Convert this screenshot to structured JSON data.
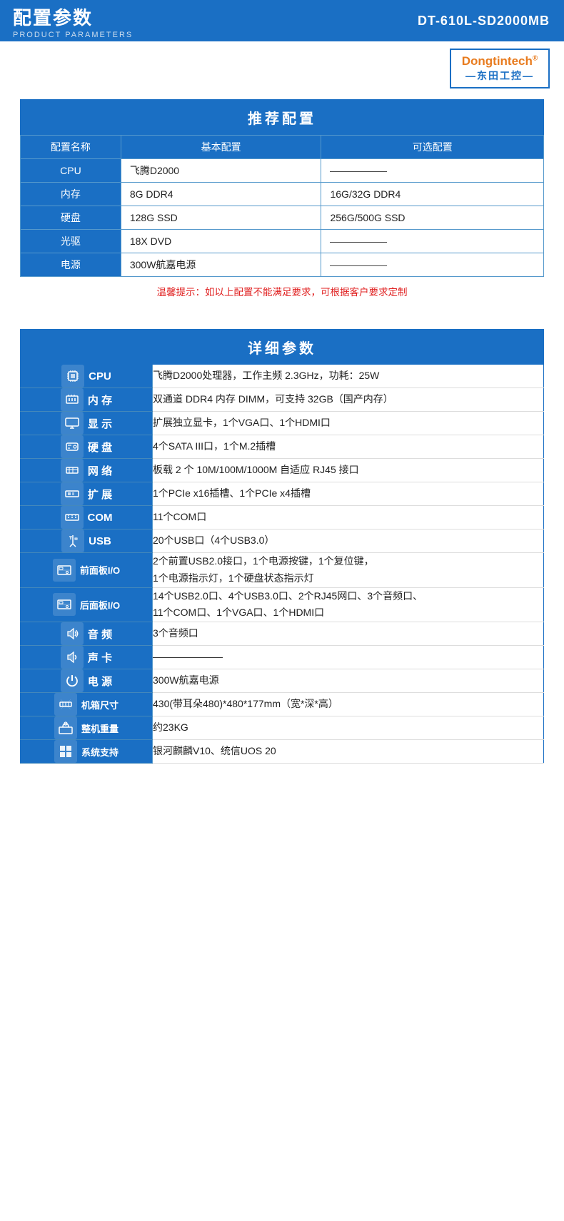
{
  "header": {
    "main_title": "配置参数",
    "sub_title": "PRODUCT PARAMETERS",
    "model": "DT-610L-SD2000MB"
  },
  "logo": {
    "brand_en": "Dongtintech",
    "brand_cn": "—东田工控—",
    "registered": "®"
  },
  "recommend": {
    "section_title": "推荐配置",
    "col_name": "配置名称",
    "col_basic": "基本配置",
    "col_optional": "可选配置",
    "rows": [
      {
        "name": "CPU",
        "basic": "飞腾D2000",
        "optional": "——"
      },
      {
        "name": "内存",
        "basic": "8G DDR4",
        "optional": "16G/32G DDR4"
      },
      {
        "name": "硬盘",
        "basic": "128G SSD",
        "optional": "256G/500G SSD"
      },
      {
        "name": "光驱",
        "basic": "18X DVD",
        "optional": "——"
      },
      {
        "name": "电源",
        "basic": "300W航嘉电源",
        "optional": "——"
      }
    ],
    "warm_tip": "温馨提示：如以上配置不能满足要求，可根据客户要求定制"
  },
  "detail": {
    "section_title": "详细参数",
    "rows": [
      {
        "label": "CPU",
        "icon": "cpu",
        "value": "飞腾D2000处理器，工作主频 2.3GHz，功耗：25W"
      },
      {
        "label": "内 存",
        "icon": "memory",
        "value": "双通道 DDR4 内存 DIMM，可支持 32GB（国产内存）"
      },
      {
        "label": "显 示",
        "icon": "display",
        "value": "扩展独立显卡，1个VGA口、1个HDMI口"
      },
      {
        "label": "硬 盘",
        "icon": "hdd",
        "value": "4个SATA III口，1个M.2插槽"
      },
      {
        "label": "网 络",
        "icon": "network",
        "value": "板载 2 个 10M/100M/1000M 自适应 RJ45 接口"
      },
      {
        "label": "扩 展",
        "icon": "expand",
        "value": "1个PCIe x16插槽、1个PCIe x4插槽"
      },
      {
        "label": "COM",
        "icon": "com",
        "value": "11个COM口"
      },
      {
        "label": "USB",
        "icon": "usb",
        "value": "20个USB口（4个USB3.0）"
      },
      {
        "label": "前面板I/O",
        "icon": "frontio",
        "value": "2个前置USB2.0接口，1个电源按键，1个复位键，\n1个电源指示灯，1个硬盘状态指示灯"
      },
      {
        "label": "后面板I/O",
        "icon": "reario",
        "value": "14个USB2.0口、4个USB3.0口、2个RJ45网口、3个音频口、\n11个COM口、1个VGA口、1个HDMI口"
      },
      {
        "label": "音 频",
        "icon": "audio",
        "value": "3个音频口"
      },
      {
        "label": "声 卡",
        "icon": "soundcard",
        "value": "———————"
      },
      {
        "label": "电 源",
        "icon": "power",
        "value": "300W航嘉电源"
      },
      {
        "label": "机箱尺寸",
        "icon": "chassis",
        "value": "430(带耳朵480)*480*177mm（宽*深*高）"
      },
      {
        "label": "整机重量",
        "icon": "weight",
        "value": "约23KG"
      },
      {
        "label": "系统支持",
        "icon": "os",
        "value": "银河麒麟V10、统信UOS 20"
      }
    ]
  }
}
